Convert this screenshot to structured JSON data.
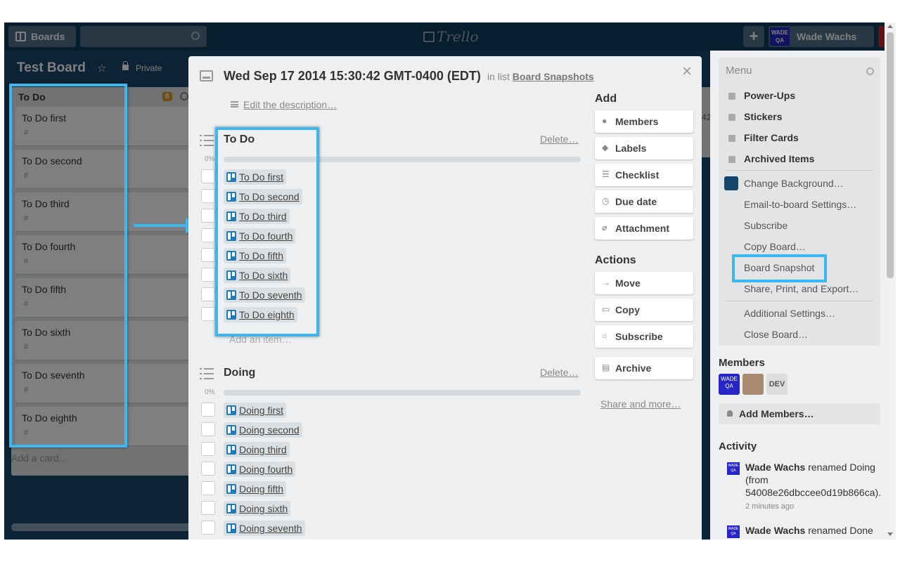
{
  "header": {
    "boards_label": "Boards",
    "logo_text": "Trello",
    "plus_label": "+",
    "member_name": "Wade Wachs",
    "member_avatar_text": "WADE QA"
  },
  "board": {
    "title": "Test Board",
    "privacy": "Private",
    "list": {
      "title": "To Do",
      "count": "8",
      "cards": [
        {
          "title": "To Do first",
          "badge": "#"
        },
        {
          "title": "To Do second",
          "badge": "#"
        },
        {
          "title": "To Do third",
          "badge": "#"
        },
        {
          "title": "To Do fourth",
          "badge": "#"
        },
        {
          "title": "To Do fifth",
          "badge": "#"
        },
        {
          "title": "To Do sixth",
          "badge": "#"
        },
        {
          "title": "To Do seventh",
          "badge": "#"
        },
        {
          "title": "To Do eighth",
          "badge": "#"
        }
      ],
      "add_card": "Add a card…"
    },
    "right_peek_text": "42"
  },
  "modal": {
    "title": "Wed Sep 17 2014 15:30:42 GMT-0400 (EDT)",
    "in_list_prefix": "in list",
    "list_name": "Board Snapshots",
    "close": "×",
    "edit_description": "Edit the description…",
    "checklists": [
      {
        "title": "To Do",
        "delete": "Delete…",
        "percent": "0%",
        "items": [
          "To Do first",
          "To Do second",
          "To Do third",
          "To Do fourth",
          "To Do fifth",
          "To Do sixth",
          "To Do seventh",
          "To Do eighth"
        ],
        "add_item": "Add an item…"
      },
      {
        "title": "Doing",
        "delete": "Delete…",
        "percent": "0%",
        "items": [
          "Doing first",
          "Doing second",
          "Doing third",
          "Doing fourth",
          "Doing fifth",
          "Doing sixth",
          "Doing seventh"
        ]
      }
    ],
    "add_heading": "Add",
    "add_buttons": [
      "Members",
      "Labels",
      "Checklist",
      "Due date",
      "Attachment"
    ],
    "actions_heading": "Actions",
    "action_buttons": [
      "Move",
      "Copy",
      "Subscribe"
    ],
    "archive_button": "Archive",
    "share_more": "Share and more…"
  },
  "sidebar": {
    "menu_title": "Menu",
    "menu_items_bold": [
      "Power-Ups",
      "Stickers",
      "Filter Cards",
      "Archived Items"
    ],
    "menu_items": [
      "Change Background…",
      "Email-to-board Settings…",
      "Subscribe",
      "Copy Board…",
      "Board Snapshot",
      "Share, Print, and Export…",
      "Additional Settings…",
      "Close Board…"
    ],
    "members_heading": "Members",
    "member_avatars": [
      "WADE QA",
      "",
      "DEV"
    ],
    "add_members": "Add Members…",
    "activity_heading": "Activity",
    "activity": [
      {
        "user": "Wade Wachs",
        "text": "renamed Doing (from 54008e26dbccee0d19b866ca).",
        "time": "2 minutes ago"
      },
      {
        "user": "Wade Wachs",
        "text": "renamed Done",
        "time": ""
      }
    ]
  },
  "colors": {
    "board_bg": "#16476a",
    "header_bg": "#0e3d5e",
    "callout": "#3db7f0",
    "card_icon_blue": "#1c7bbb",
    "notif_red": "#c0272d"
  }
}
